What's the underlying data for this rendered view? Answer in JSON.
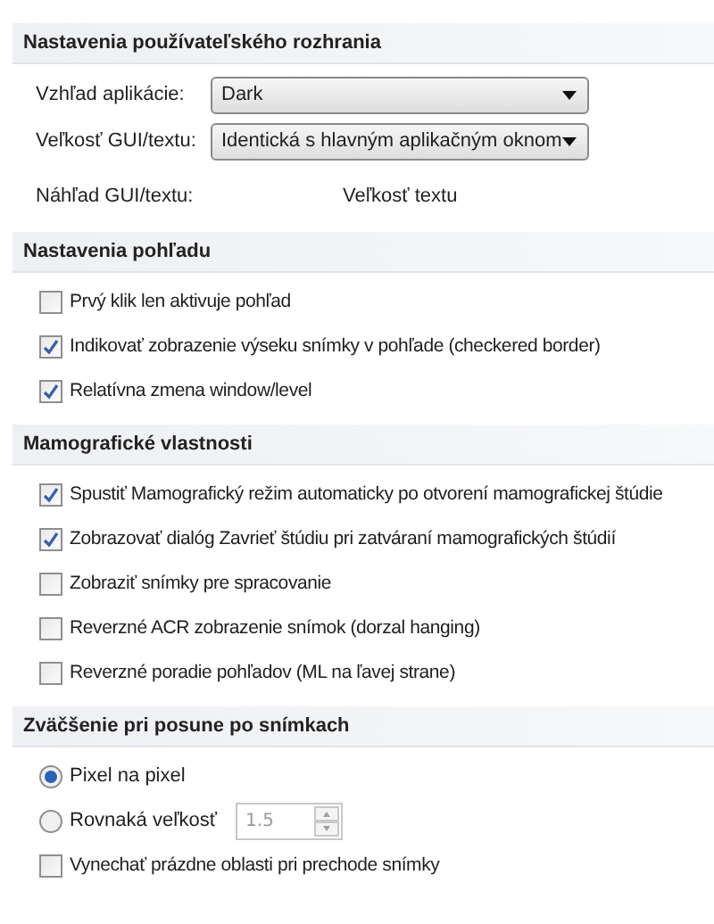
{
  "sections": [
    {
      "title": "Nastavenia používateľského rozhrania",
      "items": [
        {
          "kind": "dropdown",
          "label": "Vzhľad aplikácie:",
          "value": "Dark"
        },
        {
          "kind": "dropdown",
          "label": "Veľkosť GUI/textu:",
          "value": "Identická s hlavným aplikačným oknom"
        },
        {
          "kind": "preview",
          "label": "Náhľad GUI/textu:",
          "value": "Veľkosť textu"
        }
      ]
    },
    {
      "title": "Nastavenia pohľadu",
      "items": [
        {
          "kind": "checkbox",
          "label": "Prvý klik len aktivuje pohľad",
          "checked": false
        },
        {
          "kind": "checkbox",
          "label": "Indikovať zobrazenie výseku snímky v pohľade (checkered border)",
          "checked": true
        },
        {
          "kind": "checkbox",
          "label": "Relatívna zmena window/level",
          "checked": true
        }
      ]
    },
    {
      "title": "Mamografické vlastnosti",
      "items": [
        {
          "kind": "checkbox",
          "label": "Spustiť Mamografický režim automaticky po otvorení mamografickej štúdie",
          "checked": true
        },
        {
          "kind": "checkbox",
          "label": "Zobrazovať dialóg Zavrieť štúdiu pri zatváraní mamografických štúdií",
          "checked": true
        },
        {
          "kind": "checkbox",
          "label": "Zobraziť snímky pre spracovanie",
          "checked": false
        },
        {
          "kind": "checkbox",
          "label": "Reverzné ACR zobrazenie snímok (dorzal hanging)",
          "checked": false
        },
        {
          "kind": "checkbox",
          "label": "Reverzné poradie pohľadov (ML na ľavej strane)",
          "checked": false
        }
      ]
    },
    {
      "title": "Zväčšenie pri posune po snímkach",
      "items": [
        {
          "kind": "radio",
          "label": "Pixel na pixel",
          "selected": true
        },
        {
          "kind": "radio",
          "label": "Rovnaká veľkosť",
          "selected": false,
          "spinner": {
            "value": "1.5",
            "disabled": true
          }
        },
        {
          "kind": "checkbox",
          "label": "Vynechať prázdne oblasti pri prechode snímky",
          "checked": false
        }
      ]
    }
  ]
}
